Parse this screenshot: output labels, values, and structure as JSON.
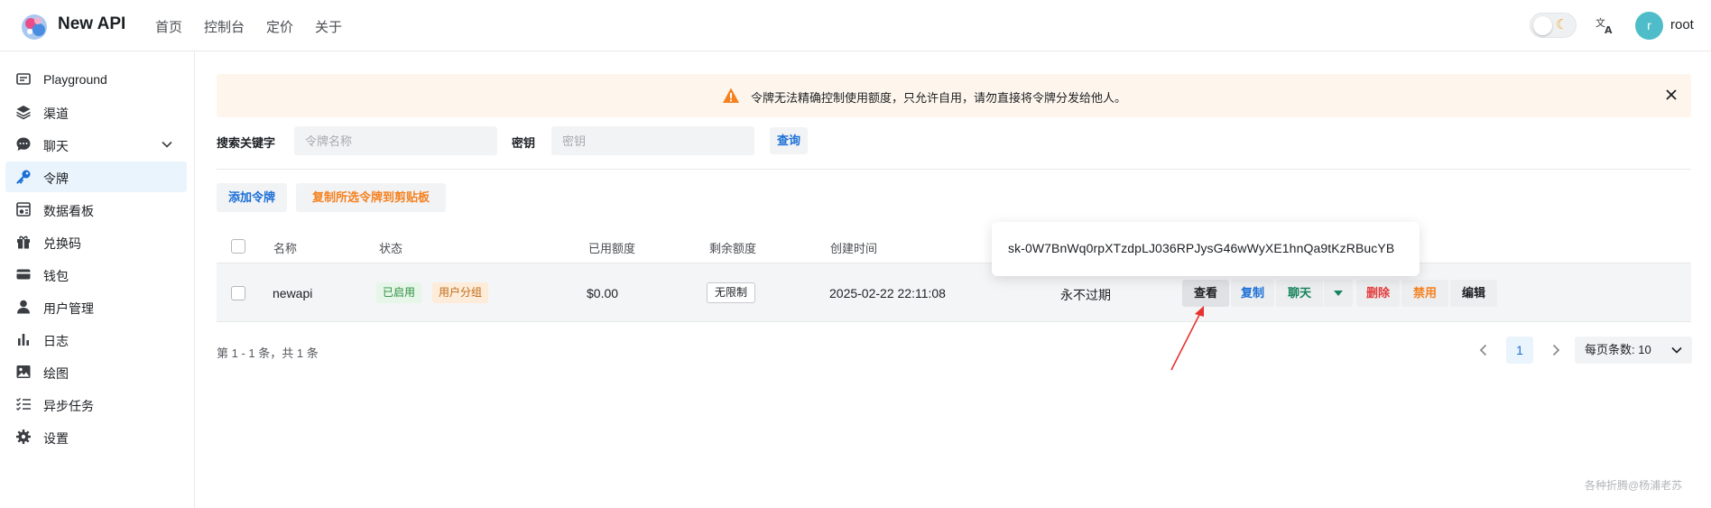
{
  "header": {
    "app_title": "New API",
    "nav": [
      "首页",
      "控制台",
      "定价",
      "关于"
    ],
    "avatar_letter": "r",
    "username": "root"
  },
  "sidebar": {
    "items": [
      {
        "label": "Playground",
        "icon": "playground-icon"
      },
      {
        "label": "渠道",
        "icon": "layers-icon"
      },
      {
        "label": "聊天",
        "icon": "chat-icon"
      },
      {
        "label": "令牌",
        "icon": "key-icon"
      },
      {
        "label": "数据看板",
        "icon": "dashboard-icon"
      },
      {
        "label": "兑换码",
        "icon": "gift-icon"
      },
      {
        "label": "钱包",
        "icon": "wallet-icon"
      },
      {
        "label": "用户管理",
        "icon": "user-icon"
      },
      {
        "label": "日志",
        "icon": "chart-bar-icon"
      },
      {
        "label": "绘图",
        "icon": "image-icon"
      },
      {
        "label": "异步任务",
        "icon": "task-list-icon"
      },
      {
        "label": "设置",
        "icon": "gear-icon"
      }
    ],
    "active": "令牌"
  },
  "banner": {
    "text": "令牌无法精确控制使用额度，只允许自用，请勿直接将令牌分发给他人。"
  },
  "search": {
    "keyword_label": "搜索关键字",
    "name_placeholder": "令牌名称",
    "key_label": "密钥",
    "key_placeholder": "密钥",
    "query_button": "查询"
  },
  "toolbar": {
    "add_button": "添加令牌",
    "copy_selected_button": "复制所选令牌到剪贴板"
  },
  "table": {
    "columns": [
      "名称",
      "状态",
      "已用额度",
      "剩余额度",
      "创建时间"
    ],
    "rows": [
      {
        "name": "newapi",
        "status": "已启用",
        "group": "用户分组",
        "used": "$0.00",
        "remaining": "无限制",
        "created": "2025-02-22 22:11:08",
        "expires": "永不过期",
        "actions": {
          "view": "查看",
          "copy": "复制",
          "chat": "聊天",
          "delete": "删除",
          "disable": "禁用",
          "edit": "编辑"
        }
      }
    ]
  },
  "popover": {
    "key": "sk-0W7BnWq0rpXTzdpLJ036RPJysG46wWyXE1hnQa9tKzRBucYB"
  },
  "pagination": {
    "info": "第 1 - 1 条，共 1 条",
    "current_page": "1",
    "page_size": "每页条数: 10"
  },
  "watermark": "各种折腾@杨浦老苏",
  "colors": {
    "accent": "#1a6fd6",
    "warning": "#f5811f",
    "success": "#17845c",
    "danger": "#e43b3b"
  }
}
